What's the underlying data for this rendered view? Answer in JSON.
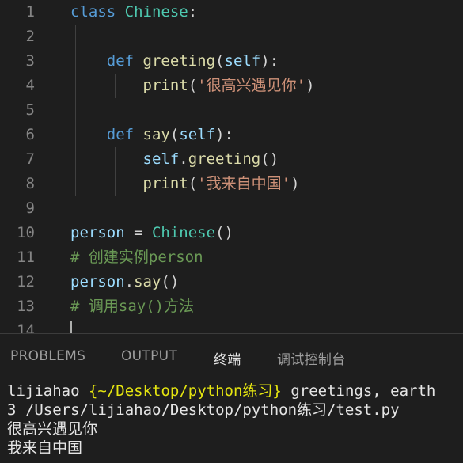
{
  "editor": {
    "lines": [
      {
        "num": "1",
        "tokens": [
          {
            "t": "class ",
            "c": "kw"
          },
          {
            "t": "Chinese",
            "c": "cls"
          },
          {
            "t": ":",
            "c": "p"
          }
        ]
      },
      {
        "num": "2",
        "tokens": []
      },
      {
        "num": "3",
        "tokens": [
          {
            "t": "    ",
            "c": "p"
          },
          {
            "t": "def ",
            "c": "kw"
          },
          {
            "t": "greeting",
            "c": "fn"
          },
          {
            "t": "(",
            "c": "p"
          },
          {
            "t": "self",
            "c": "self"
          },
          {
            "t": "):",
            "c": "p"
          }
        ]
      },
      {
        "num": "4",
        "tokens": [
          {
            "t": "        ",
            "c": "p"
          },
          {
            "t": "print",
            "c": "fn"
          },
          {
            "t": "(",
            "c": "p"
          },
          {
            "t": "'很高兴遇见你'",
            "c": "str"
          },
          {
            "t": ")",
            "c": "p"
          }
        ]
      },
      {
        "num": "5",
        "tokens": []
      },
      {
        "num": "6",
        "tokens": [
          {
            "t": "    ",
            "c": "p"
          },
          {
            "t": "def ",
            "c": "kw"
          },
          {
            "t": "say",
            "c": "fn"
          },
          {
            "t": "(",
            "c": "p"
          },
          {
            "t": "self",
            "c": "self"
          },
          {
            "t": "):",
            "c": "p"
          }
        ]
      },
      {
        "num": "7",
        "tokens": [
          {
            "t": "        ",
            "c": "p"
          },
          {
            "t": "self",
            "c": "self"
          },
          {
            "t": ".",
            "c": "p"
          },
          {
            "t": "greeting",
            "c": "fn"
          },
          {
            "t": "()",
            "c": "p"
          }
        ]
      },
      {
        "num": "8",
        "tokens": [
          {
            "t": "        ",
            "c": "p"
          },
          {
            "t": "print",
            "c": "fn"
          },
          {
            "t": "(",
            "c": "p"
          },
          {
            "t": "'我来自中国'",
            "c": "str"
          },
          {
            "t": ")",
            "c": "p"
          }
        ]
      },
      {
        "num": "9",
        "tokens": []
      },
      {
        "num": "10",
        "tokens": [
          {
            "t": "person",
            "c": "var"
          },
          {
            "t": " = ",
            "c": "p"
          },
          {
            "t": "Chinese",
            "c": "cls"
          },
          {
            "t": "()",
            "c": "p"
          }
        ]
      },
      {
        "num": "11",
        "tokens": [
          {
            "t": "# 创建实例person",
            "c": "cm"
          }
        ]
      },
      {
        "num": "12",
        "tokens": [
          {
            "t": "person",
            "c": "var"
          },
          {
            "t": ".",
            "c": "p"
          },
          {
            "t": "say",
            "c": "fn"
          },
          {
            "t": "()",
            "c": "p"
          }
        ]
      },
      {
        "num": "13",
        "tokens": [
          {
            "t": "# 调用say()方法",
            "c": "cm"
          }
        ]
      },
      {
        "num": "14",
        "tokens": []
      }
    ]
  },
  "panel": {
    "tabs": [
      {
        "label": "PROBLEMS",
        "active": false
      },
      {
        "label": "OUTPUT",
        "active": false
      },
      {
        "label": "终端",
        "active": true
      },
      {
        "label": "调试控制台",
        "active": false
      }
    ]
  },
  "terminal": {
    "prompt_user": "lijiahao",
    "prompt_path": "{~/Desktop/python练习}",
    "prompt_cmd": " greetings, earth",
    "line2": "3 /Users/lijiahao/Desktop/python练习/test.py",
    "output1": "很高兴遇见你",
    "output2": "我来自中国"
  },
  "colors": {
    "background": "#1e1e1e",
    "keyword": "#569cd6",
    "class_name": "#4ec9b0",
    "function": "#dcdcaa",
    "variable": "#9cdcfe",
    "string": "#ce9178",
    "comment": "#6a9955"
  }
}
